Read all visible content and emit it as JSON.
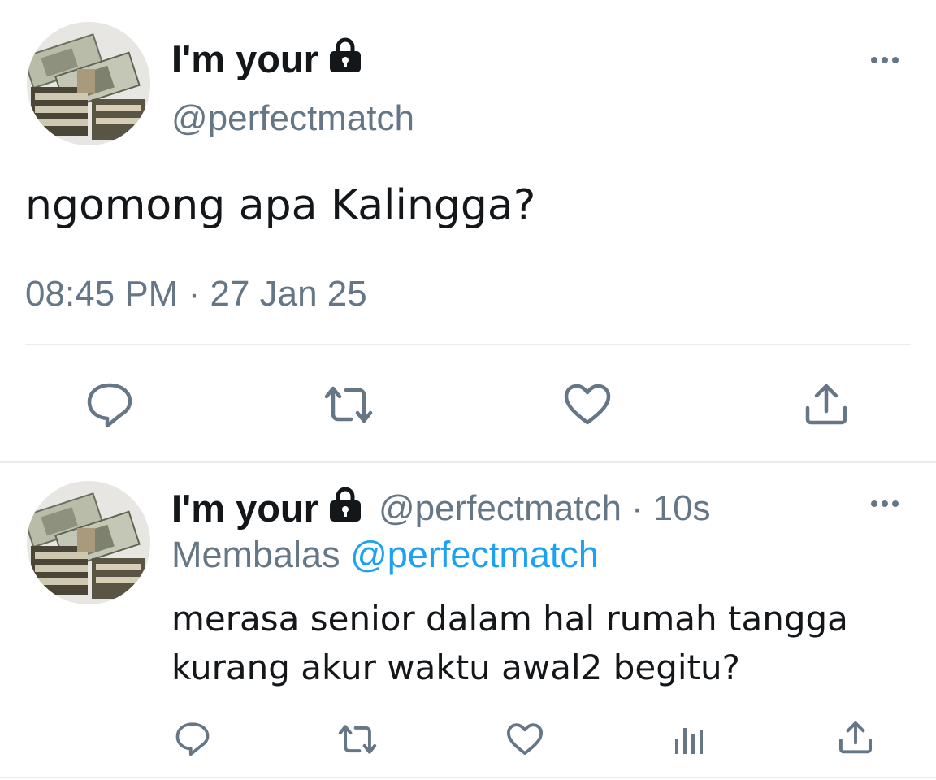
{
  "main_tweet": {
    "display_name": "I'm your",
    "handle": "@perfectmatch",
    "text": "ngomong apa Kalingga?",
    "time": "08:45 PM",
    "separator": "·",
    "date": "27 Jan 25"
  },
  "reply_tweet": {
    "display_name": "I'm your",
    "handle": "@perfectmatch",
    "separator": "·",
    "age": "10s",
    "replying_label": "Membalas",
    "replying_to": "@perfectmatch",
    "text_line1": "merasa senior dalam hal rumah tangga",
    "text_line2": "kurang akur waktu awal2 begitu?"
  },
  "icons": {
    "lock": "lock-icon",
    "more": "more-horizontal-icon",
    "reply": "reply-icon",
    "retweet": "retweet-icon",
    "like": "heart-icon",
    "analytics": "analytics-icon",
    "share": "share-icon"
  },
  "colors": {
    "text": "#14171a",
    "secondary": "#657786",
    "link": "#1da1f2",
    "divider": "#e6ecf0"
  }
}
